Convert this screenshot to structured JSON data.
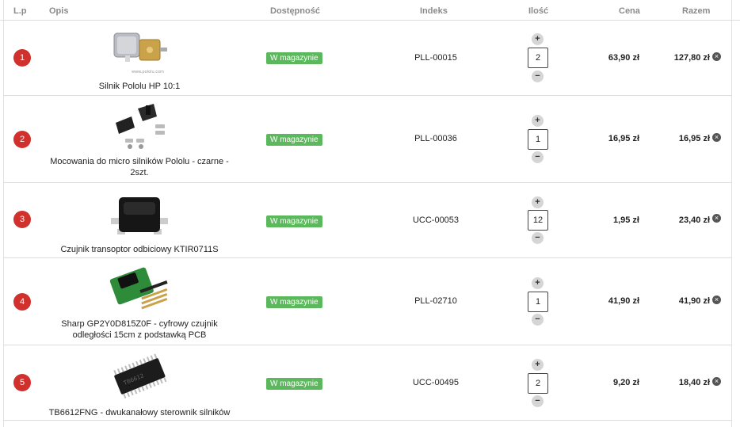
{
  "columns": {
    "lp": "L.p",
    "opis": "Opis",
    "dostepnosc": "Dostępność",
    "indeks": "Indeks",
    "ilosc": "Ilość",
    "cena": "Cena",
    "razem": "Razem"
  },
  "controls": {
    "plus": "+",
    "minus": "−",
    "remove": "×"
  },
  "rows": [
    {
      "lp": "1",
      "name": "Silnik Pololu HP 10:1",
      "availability": "W magazynie",
      "index": "PLL-00015",
      "qty": "2",
      "price": "63,90 zł",
      "total": "127,80 zł"
    },
    {
      "lp": "2",
      "name": "Mocowania do micro silników Pololu - czarne - 2szt.",
      "availability": "W magazynie",
      "index": "PLL-00036",
      "qty": "1",
      "price": "16,95 zł",
      "total": "16,95 zł"
    },
    {
      "lp": "3",
      "name": "Czujnik transoptor odbiciowy KTIR0711S",
      "availability": "W magazynie",
      "index": "UCC-00053",
      "qty": "12",
      "price": "1,95 zł",
      "total": "23,40 zł"
    },
    {
      "lp": "4",
      "name": "Sharp GP2Y0D815Z0F - cyfrowy czujnik odległości 15cm z podstawką PCB",
      "availability": "W magazynie",
      "index": "PLL-02710",
      "qty": "1",
      "price": "41,90 zł",
      "total": "41,90 zł"
    },
    {
      "lp": "5",
      "name": "TB6612FNG - dwukanałowy sterownik silników",
      "availability": "W magazynie",
      "index": "UCC-00495",
      "qty": "2",
      "price": "9,20 zł",
      "total": "18,40 zł"
    }
  ]
}
